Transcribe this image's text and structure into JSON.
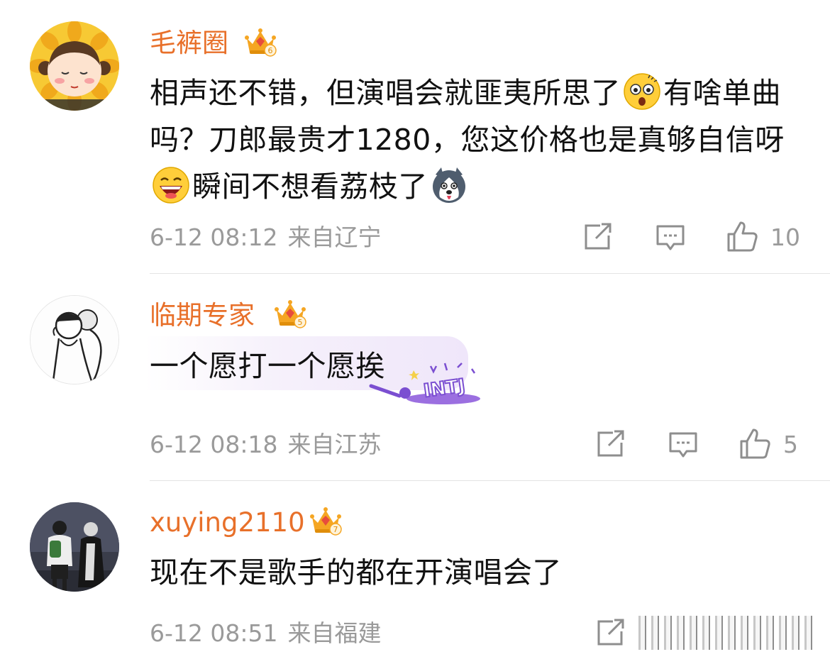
{
  "comments": [
    {
      "username": "毛裤圈",
      "badge_level": "6",
      "text_1": "相声还不错，但演唱会就匪夷所思了",
      "emoji_1": "shocked-face-emoji",
      "text_2": "有啥单曲吗？刀郎最贵才1280，您这价格也是真够自信呀",
      "emoji_2": "laughing-face-emoji",
      "text_3": "瞬间不想看荔枝了",
      "emoji_3": "husky-dog-emoji",
      "time": "6-12 08:12",
      "location": "来自辽宁",
      "likes": "10"
    },
    {
      "username": "临期专家",
      "badge_level": "5",
      "text_1": "一个愿打一个愿挨",
      "decoration_label": "INTJ",
      "time": "6-12 08:18",
      "location": "来自江苏",
      "likes": "5"
    },
    {
      "username": "xuying2110",
      "badge_level": "7",
      "text_1": "现在不是歌手的都在开演唱会了",
      "time": "6-12 08:51",
      "location": "来自福建",
      "likes": ""
    }
  ],
  "colors": {
    "username": "#e8702a",
    "text": "#111111",
    "meta": "#9a9a9a",
    "badge": "#f5a623",
    "divider": "#e4e4e4"
  },
  "icons": [
    "share-icon",
    "comment-icon",
    "like-icon",
    "crown-badge-icon"
  ]
}
